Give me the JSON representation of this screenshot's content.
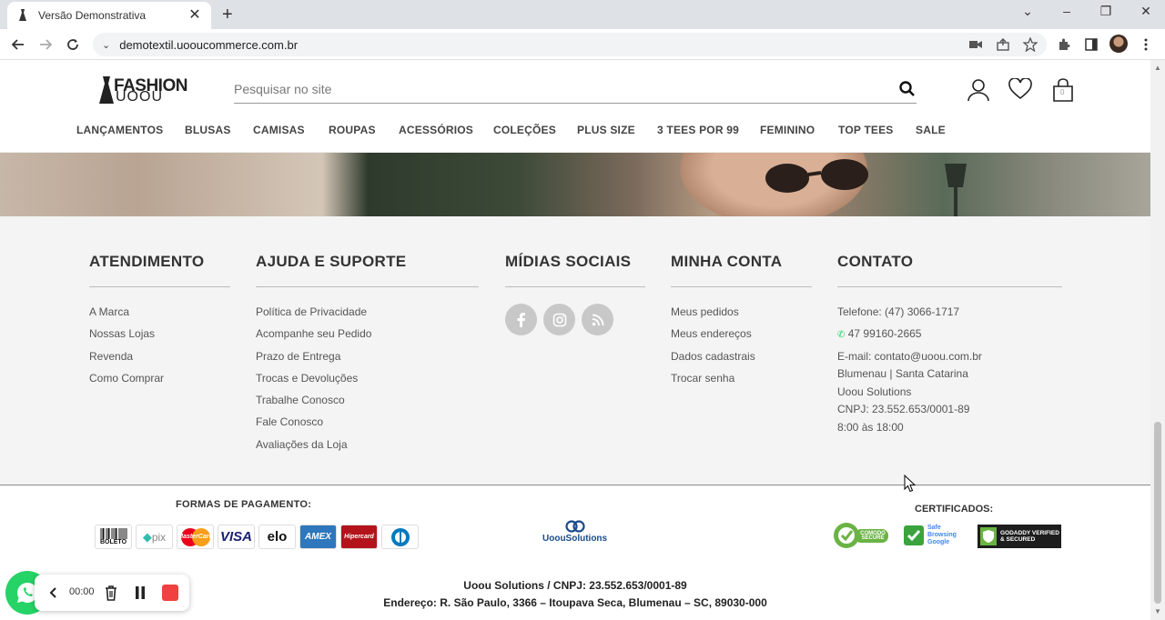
{
  "browser": {
    "tab_title": "Versão Demonstrativa",
    "url": "demotextil.uooucommerce.com.br"
  },
  "header": {
    "logo_top": "FASHION",
    "logo_bottom": "UOOU",
    "search_placeholder": "Pesquisar no site",
    "menu": [
      "LANÇAMENTOS",
      "BLUSAS",
      "CAMISAS",
      "ROUPAS",
      "ACESSÓRIOS",
      "COLEÇÕES",
      "PLUS SIZE",
      "3 TEES POR 99",
      "FEMININO",
      "TOP TEES",
      "SALE"
    ],
    "cart_count": "0"
  },
  "footer": {
    "atendimento": {
      "title": "ATENDIMENTO",
      "items": [
        "A Marca",
        "Nossas Lojas",
        "Revenda",
        "Como Comprar"
      ]
    },
    "ajuda": {
      "title": "AJUDA E SUPORTE",
      "items": [
        "Política de Privacidade",
        "Acompanhe seu Pedido",
        "Prazo de Entrega",
        "Trocas e Devoluções",
        "Trabalhe Conosco",
        "Fale Conosco",
        "Avaliações da Loja"
      ]
    },
    "midias": {
      "title": "MÍDIAS SOCIAIS",
      "icons": [
        "facebook-icon",
        "instagram-icon",
        "rss-icon"
      ]
    },
    "conta": {
      "title": "MINHA CONTA",
      "items": [
        "Meus pedidos",
        "Meus endereços",
        "Dados cadastrais",
        "Trocar senha"
      ]
    },
    "contato": {
      "title": "CONTATO",
      "telefone": "Telefone: (47) 3066-1717",
      "whatsapp": "47 99160-2665",
      "email": "E-mail: contato@uoou.com.br",
      "cidade": "Blumenau | Santa Catarina",
      "empresa": "Uoou Solutions",
      "cnpj": "CNPJ: 23.552.653/0001-89",
      "horario": "8:00 às 18:00"
    }
  },
  "bottom": {
    "payments_title": "FORMAS DE PAGAMENTO:",
    "payments": [
      "BOLETO",
      "pix",
      "MasterCard",
      "VISA",
      "elo",
      "AMEX",
      "Hipercard",
      "Diners"
    ],
    "uoou_label": "UoouSolutions",
    "certs_title": "CERTIFICADOS:",
    "certs": [
      "COMODO SECURE",
      "Safe Browsing Google",
      "GODADDY VERIFIED & SECURED"
    ],
    "legal_line1": "Uoou Solutions / CNPJ: 23.552.653/0001-89",
    "legal_line2": "Endereço: R. São Paulo, 3366 – Itoupava Seca, Blumenau – SC, 89030-000"
  },
  "recorder": {
    "time": "00:00"
  },
  "colors": {
    "whatsapp": "#25d366",
    "record": "#f04040",
    "footer_bg": "#f4f4f4"
  }
}
